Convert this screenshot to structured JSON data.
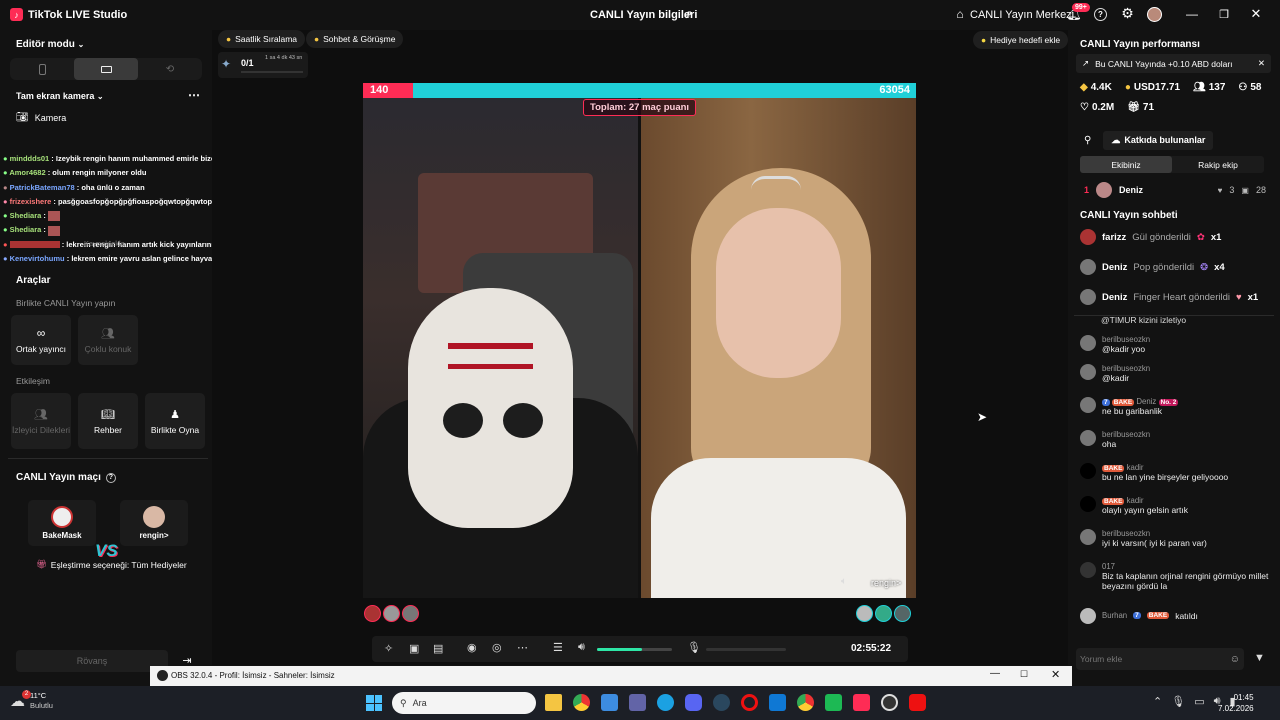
{
  "titlebar": {
    "app": "TikTok LIVE Studio",
    "center_title": "CANLI Yayın bilgileri",
    "merkezi": "CANLI Yayın Merkezi",
    "notif_badge": "99+"
  },
  "left": {
    "editor_mode": "Editör modu",
    "camera_section": "Tam ekran kamera",
    "camera_item": "Kamera",
    "chat": [
      {
        "user": "minddds01",
        "text": "Izeybik rengin hanım muhammed emirle bize dubai turu ayarlar mı acaba",
        "color": "#a6e07a"
      },
      {
        "user": "Amor4682",
        "text": "olum rengin milyoner oldu",
        "color": "#a6e07a"
      },
      {
        "user": "PatrickBateman78",
        "text": "oha ünlü o zaman",
        "color": "#7aa6ff"
      },
      {
        "user": "frizexishere",
        "text": "pasğgoasfopğopğpğfioaspoğqwtopğqwtopğqtwopğqtwopğtwqopğ",
        "color": "#ff7a7a"
      },
      {
        "user": "Shediara",
        "text": "",
        "color": "#a6e07a"
      },
      {
        "user": "Shediara",
        "text": "",
        "color": "#a6e07a"
      },
      {
        "user": "",
        "text": "lekrem rengin hanım artık kick yayınlarını daha sık açarsınız",
        "color": "#ff6a6a"
      },
      {
        "user": "Kenevirtohumu",
        "text": "lekrem emire yavru aslan gelince hayvanat bahçesine aslan görmeye gitti",
        "color": "#7aa6ff"
      }
    ],
    "overlay_label": "Kaynak ekle",
    "tools_title": "Araçlar",
    "together_title": "Birlikte CANLI Yayın yapın",
    "tools_together": [
      {
        "label": "Ortak yayıncı",
        "enabled": true
      },
      {
        "label": "Çoklu konuk",
        "enabled": false
      }
    ],
    "interaction_title": "Etkileşim",
    "tools_interaction": [
      {
        "label": "İzleyici Dilekleri",
        "enabled": false
      },
      {
        "label": "Rehber",
        "enabled": true
      },
      {
        "label": "Birlikte Oyna",
        "enabled": true
      }
    ],
    "match_title": "CANLI Yayın maçı",
    "player1": "BakeMask",
    "player2": "rengin>",
    "vs": "VS",
    "match_option": "Eşleştirme seçeneği: Tüm Hediyeler",
    "rematch": "Rövanş"
  },
  "center": {
    "pill1": "Saatlik Sıralama",
    "pill2": "Sohbet & Görüşme",
    "goal_btn": "Hediye hedefi ekle",
    "progress": "0/1",
    "timer_small": "1 sa 4 dk 43 sn",
    "score_left": "140",
    "score_right": "63054",
    "score_left_fraction": 0.0022,
    "total_points": "Toplam: 27 maç puanı",
    "opponent_label": "rengin>",
    "elapsed": "02:55:22",
    "volume_level": 0.6
  },
  "right": {
    "perf_title": "CANLI Yayın performansı",
    "notice": "Bu CANLI Yayında +0.10 ABD doları",
    "stats": [
      {
        "icon": "diamond",
        "value": "4.4K"
      },
      {
        "icon": "coin",
        "value": "USD17.71"
      },
      {
        "icon": "people",
        "value": "137"
      },
      {
        "icon": "followers",
        "value": "58"
      }
    ],
    "stats2": [
      {
        "icon": "eye",
        "value": "0.2M"
      },
      {
        "icon": "gift",
        "value": "71"
      }
    ],
    "contributors_btn": "Katkıda bulunanlar",
    "tab_team": "Ekibiniz",
    "tab_rival": "Rakip ekip",
    "contributor": {
      "rank": "1",
      "name": "Deniz",
      "likes": "3",
      "gifts": "28"
    },
    "chat_title": "CANLI Yayın sohbeti",
    "gifts": [
      {
        "user": "farizz",
        "action": "Gül gönderildi",
        "count": "x1"
      },
      {
        "user": "Deniz",
        "action": "Pop gönderildi",
        "count": "x4"
      },
      {
        "user": "Deniz",
        "action": "Finger Heart gönderildi",
        "count": "x1"
      }
    ],
    "cut_line": "@TIMUR kizini izletiyo",
    "messages": [
      {
        "user": "berilbuseozkn",
        "text": "@kadir yoo"
      },
      {
        "user": "berilbuseozkn",
        "text": "@kadir"
      },
      {
        "user": "Deniz",
        "text": "ne bu garibanlik",
        "badges": [
          "7",
          "BAKE",
          "No. 2"
        ]
      },
      {
        "user": "berilbuseozkn",
        "text": "oha"
      },
      {
        "user": "kadir",
        "text": "bu ne lan yine birşeyler geliyoooo",
        "badges": [
          "BAKE"
        ]
      },
      {
        "user": "kadir",
        "text": "olaylı yayın gelsin artık",
        "badges": [
          "BAKE"
        ]
      },
      {
        "user": "berilbuseozkn",
        "text": "iyi ki varsın( iyi ki paran var)"
      },
      {
        "user": "017",
        "text": "Biz ta kaplanın orjinal rengini görmüyo millet beyazını gördü la"
      }
    ],
    "join": {
      "user": "Burhan",
      "text": "katıldı",
      "badges": [
        "7",
        "BAKE"
      ]
    },
    "comment_placeholder": "Yorum ekle"
  },
  "obs": {
    "title": "OBS 32.0.4 - Profil: İsimsiz - Sahneler: İsimsiz"
  },
  "taskbar": {
    "temp": "11°C",
    "weather": "Bulutlu",
    "weather_badge": "2",
    "search": "Ara",
    "time": "01:45",
    "date": "7.02.2026"
  }
}
